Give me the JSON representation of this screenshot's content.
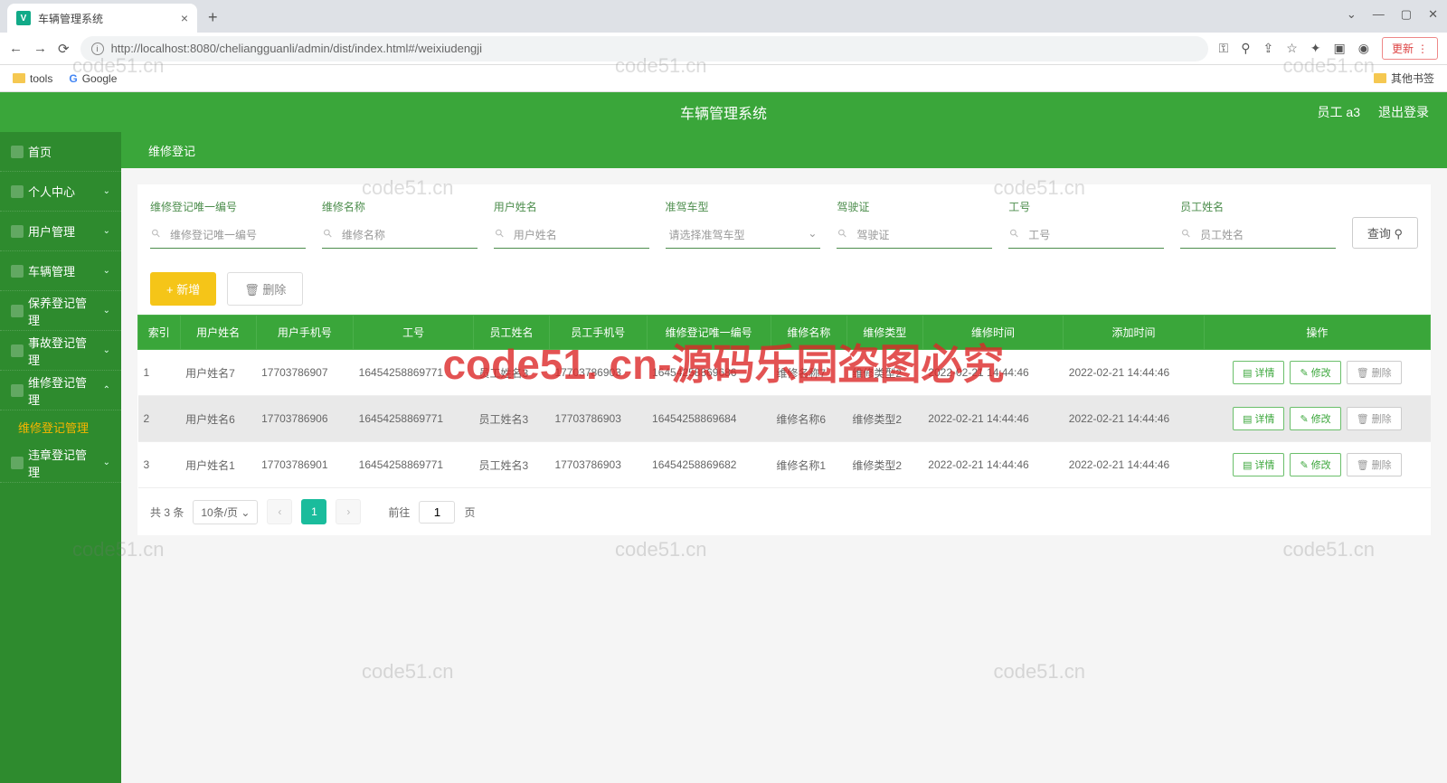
{
  "browser": {
    "tabTitle": "车辆管理系统",
    "close": "×",
    "newTab": "+",
    "winCtrls": [
      "⌄",
      "—",
      "▢",
      "✕"
    ],
    "url": "http://localhost:8080/cheliangguanli/admin/dist/index.html#/weixiudengji",
    "updateBtn": "更新",
    "bookmarks": {
      "tools": "tools",
      "google": "Google",
      "other": "其他书签"
    }
  },
  "header": {
    "title": "车辆管理系统",
    "user": "员工 a3",
    "logout": "退出登录"
  },
  "sidebar": {
    "items": [
      {
        "label": "首页",
        "arrow": ""
      },
      {
        "label": "个人中心",
        "arrow": "⌄"
      },
      {
        "label": "用户管理",
        "arrow": "⌄"
      },
      {
        "label": "车辆管理",
        "arrow": "⌄"
      },
      {
        "label": "保养登记管理",
        "arrow": "⌄"
      },
      {
        "label": "事故登记管理",
        "arrow": "⌄"
      },
      {
        "label": "维修登记管理",
        "arrow": "⌃"
      },
      {
        "label": "维修登记管理",
        "sub": true
      },
      {
        "label": "违章登记管理",
        "arrow": "⌄"
      }
    ]
  },
  "crumb": "维修登记",
  "filters": [
    {
      "label": "维修登记唯一编号",
      "ph": "维修登记唯一编号"
    },
    {
      "label": "维修名称",
      "ph": "维修名称"
    },
    {
      "label": "用户姓名",
      "ph": "用户姓名"
    },
    {
      "label": "准驾车型",
      "ph": "请选择准驾车型",
      "select": true
    },
    {
      "label": "驾驶证",
      "ph": "驾驶证"
    },
    {
      "label": "工号",
      "ph": "工号"
    },
    {
      "label": "员工姓名",
      "ph": "员工姓名"
    }
  ],
  "queryBtn": "查询 ⚲",
  "addBtn": "+ 新增",
  "delBtn": "🗑 删除",
  "columns": [
    "索引",
    "用户姓名",
    "用户手机号",
    "工号",
    "员工姓名",
    "员工手机号",
    "维修登记唯一编号",
    "维修名称",
    "维修类型",
    "维修时间",
    "添加时间",
    "操作"
  ],
  "rows": [
    {
      "idx": "1",
      "user": "用户姓名7",
      "uphone": "17703786907",
      "jobno": "16454258869771",
      "ename": "员工姓名3",
      "ephone": "17703786903",
      "code": "16454258869686",
      "rname": "维修名称7",
      "rtype": "维修类型2",
      "rtime": "2022-02-21 14:44:46",
      "atime": "2022-02-21 14:44:46"
    },
    {
      "idx": "2",
      "user": "用户姓名6",
      "uphone": "17703786906",
      "jobno": "16454258869771",
      "ename": "员工姓名3",
      "ephone": "17703786903",
      "code": "16454258869684",
      "rname": "维修名称6",
      "rtype": "维修类型2",
      "rtime": "2022-02-21 14:44:46",
      "atime": "2022-02-21 14:44:46"
    },
    {
      "idx": "3",
      "user": "用户姓名1",
      "uphone": "17703786901",
      "jobno": "16454258869771",
      "ename": "员工姓名3",
      "ephone": "17703786903",
      "code": "16454258869682",
      "rname": "维修名称1",
      "rtype": "维修类型2",
      "rtime": "2022-02-21 14:44:46",
      "atime": "2022-02-21 14:44:46"
    }
  ],
  "rowActions": {
    "detail": "详情",
    "edit": "修改",
    "del": "删除"
  },
  "pager": {
    "total": "共 3 条",
    "size": "10条/页",
    "page": "1",
    "goto": "前往",
    "gotoVal": "1",
    "gotoSuffix": "页"
  },
  "watermark": "code51.cn",
  "bigwm": "code51. cn-源码乐园盗图必究"
}
